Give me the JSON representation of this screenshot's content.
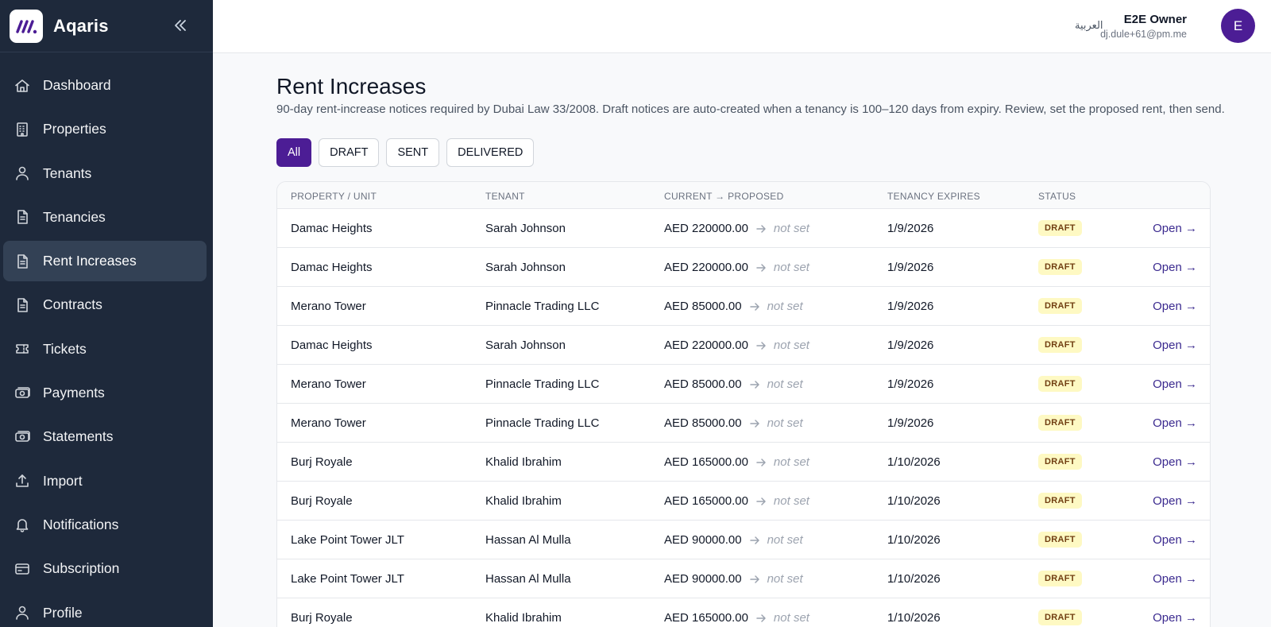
{
  "app": {
    "name": "Aqaris"
  },
  "sidebar": {
    "items": [
      {
        "label": "Dashboard",
        "icon": "home-icon",
        "active": false
      },
      {
        "label": "Properties",
        "icon": "building-icon",
        "active": false
      },
      {
        "label": "Tenants",
        "icon": "user-icon",
        "active": false
      },
      {
        "label": "Tenancies",
        "icon": "document-icon",
        "active": false
      },
      {
        "label": "Rent Increases",
        "icon": "document-icon",
        "active": true
      },
      {
        "label": "Contracts",
        "icon": "document-icon",
        "active": false
      },
      {
        "label": "Tickets",
        "icon": "ticket-icon",
        "active": false
      },
      {
        "label": "Payments",
        "icon": "cash-icon",
        "active": false
      },
      {
        "label": "Statements",
        "icon": "cash-icon",
        "active": false
      },
      {
        "label": "Import",
        "icon": "upload-icon",
        "active": false
      },
      {
        "label": "Notifications",
        "icon": "bell-icon",
        "active": false
      },
      {
        "label": "Subscription",
        "icon": "credit-card-icon",
        "active": false
      },
      {
        "label": "Profile",
        "icon": "user-icon",
        "active": false
      }
    ]
  },
  "header": {
    "language": "العربية",
    "user": {
      "name": "E2E Owner",
      "email": "dj.dule+61@pm.me",
      "initial": "E"
    }
  },
  "page": {
    "title": "Rent Increases",
    "description": "90-day rent-increase notices required by Dubai Law 33/2008. Draft notices are auto-created when a tenancy is 100–120 days from expiry. Review, set the proposed rent, then send."
  },
  "filters": [
    {
      "label": "All",
      "active": true
    },
    {
      "label": "DRAFT",
      "active": false
    },
    {
      "label": "SENT",
      "active": false
    },
    {
      "label": "DELIVERED",
      "active": false
    }
  ],
  "table": {
    "columns": [
      "PROPERTY / UNIT",
      "TENANT",
      "CURRENT → PROPOSED",
      "TENANCY EXPIRES",
      "STATUS"
    ],
    "rows": [
      {
        "property": "Damac Heights",
        "tenant": "Sarah Johnson",
        "current": "AED 220000.00",
        "proposed": "not set",
        "expires": "1/9/2026",
        "status": "DRAFT",
        "action": "Open →"
      },
      {
        "property": "Damac Heights",
        "tenant": "Sarah Johnson",
        "current": "AED 220000.00",
        "proposed": "not set",
        "expires": "1/9/2026",
        "status": "DRAFT",
        "action": "Open →"
      },
      {
        "property": "Merano Tower",
        "tenant": "Pinnacle Trading LLC",
        "current": "AED 85000.00",
        "proposed": "not set",
        "expires": "1/9/2026",
        "status": "DRAFT",
        "action": "Open →"
      },
      {
        "property": "Damac Heights",
        "tenant": "Sarah Johnson",
        "current": "AED 220000.00",
        "proposed": "not set",
        "expires": "1/9/2026",
        "status": "DRAFT",
        "action": "Open →"
      },
      {
        "property": "Merano Tower",
        "tenant": "Pinnacle Trading LLC",
        "current": "AED 85000.00",
        "proposed": "not set",
        "expires": "1/9/2026",
        "status": "DRAFT",
        "action": "Open →"
      },
      {
        "property": "Merano Tower",
        "tenant": "Pinnacle Trading LLC",
        "current": "AED 85000.00",
        "proposed": "not set",
        "expires": "1/9/2026",
        "status": "DRAFT",
        "action": "Open →"
      },
      {
        "property": "Burj Royale",
        "tenant": "Khalid Ibrahim",
        "current": "AED 165000.00",
        "proposed": "not set",
        "expires": "1/10/2026",
        "status": "DRAFT",
        "action": "Open →"
      },
      {
        "property": "Burj Royale",
        "tenant": "Khalid Ibrahim",
        "current": "AED 165000.00",
        "proposed": "not set",
        "expires": "1/10/2026",
        "status": "DRAFT",
        "action": "Open →"
      },
      {
        "property": "Lake Point Tower JLT",
        "tenant": "Hassan Al Mulla",
        "current": "AED 90000.00",
        "proposed": "not set",
        "expires": "1/10/2026",
        "status": "DRAFT",
        "action": "Open →"
      },
      {
        "property": "Lake Point Tower JLT",
        "tenant": "Hassan Al Mulla",
        "current": "AED 90000.00",
        "proposed": "not set",
        "expires": "1/10/2026",
        "status": "DRAFT",
        "action": "Open →"
      },
      {
        "property": "Burj Royale",
        "tenant": "Khalid Ibrahim",
        "current": "AED 165000.00",
        "proposed": "not set",
        "expires": "1/10/2026",
        "status": "DRAFT",
        "action": "Open →"
      }
    ]
  },
  "colors": {
    "sidebar_bg": "#1e293b",
    "accent": "#4c1d95",
    "badge_bg": "#fef9c3",
    "link": "#3b2a8f"
  }
}
